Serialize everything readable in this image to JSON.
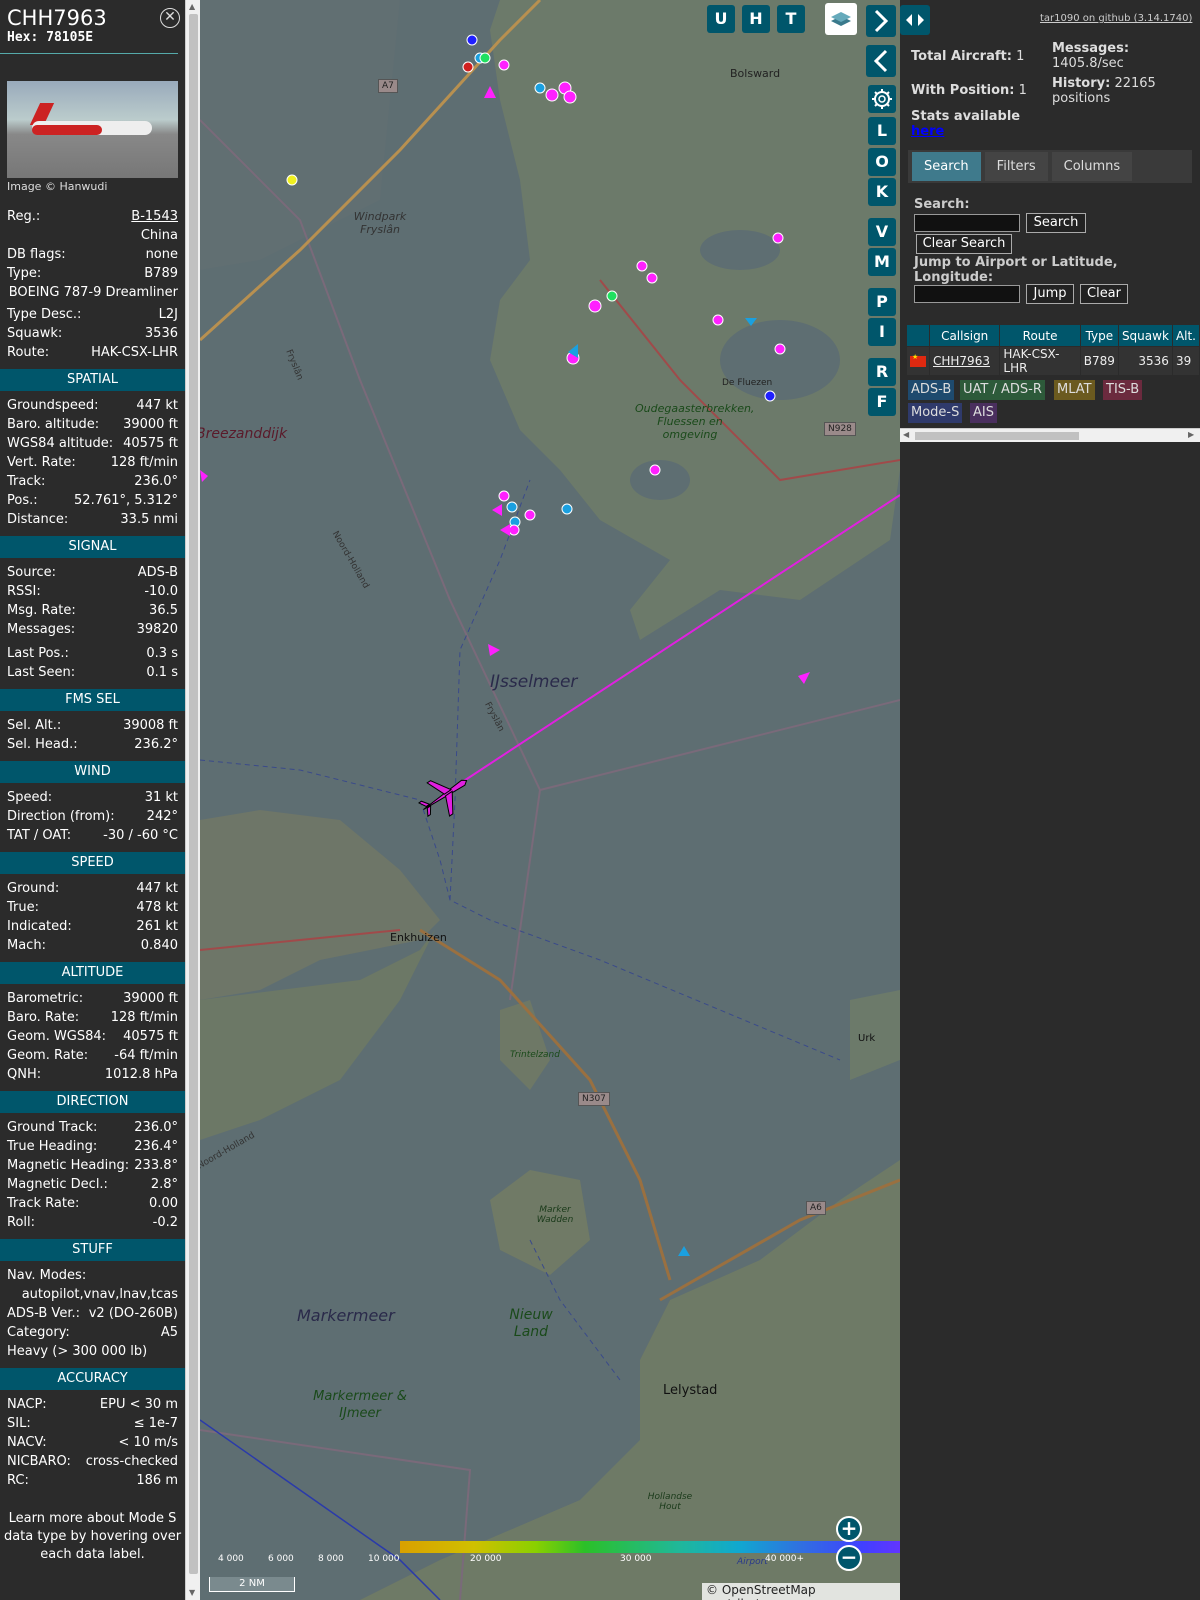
{
  "sidebar": {
    "callsign": "CHH7963",
    "hex": "Hex: 78105E",
    "photo_credit": "Image © Hanwudi",
    "reg_label": "Reg.:",
    "reg": "B-1543",
    "country": "China",
    "dbflags_label": "DB flags:",
    "dbflags": "none",
    "type_label": "Type:",
    "type": "B789",
    "type_full": "BOEING 787-9 Dreamliner",
    "typedesc_label": "Type Desc.:",
    "typedesc": "L2J",
    "squawk_label": "Squawk:",
    "squawk": "3536",
    "route_label": "Route:",
    "route": "HAK-CSX-LHR",
    "sections": {
      "spatial": "SPATIAL",
      "signal": "SIGNAL",
      "fms": "FMS SEL",
      "wind": "WIND",
      "speed": "SPEED",
      "altitude": "ALTITUDE",
      "direction": "DIRECTION",
      "stuff": "STUFF",
      "accuracy": "ACCURACY"
    },
    "spatial": [
      {
        "k": "Groundspeed:",
        "v": "447 kt"
      },
      {
        "k": "Baro. altitude:",
        "v": "39000 ft"
      },
      {
        "k": "WGS84 altitude:",
        "v": "40575 ft"
      },
      {
        "k": "Vert. Rate:",
        "v": "128 ft/min"
      },
      {
        "k": "Track:",
        "v": "236.0°"
      },
      {
        "k": "Pos.:",
        "v": "52.761°, 5.312°"
      },
      {
        "k": "Distance:",
        "v": "33.5 nmi"
      }
    ],
    "signal": [
      {
        "k": "Source:",
        "v": "ADS-B"
      },
      {
        "k": "RSSI:",
        "v": "-10.0"
      },
      {
        "k": "Msg. Rate:",
        "v": "36.5"
      },
      {
        "k": "Messages:",
        "v": "39820"
      },
      {
        "k": "Last Pos.:",
        "v": "0.3 s"
      },
      {
        "k": "Last Seen:",
        "v": "0.1 s"
      }
    ],
    "fms": [
      {
        "k": "Sel. Alt.:",
        "v": "39008 ft"
      },
      {
        "k": "Sel. Head.:",
        "v": "236.2°"
      }
    ],
    "wind": [
      {
        "k": "Speed:",
        "v": "31 kt"
      },
      {
        "k": "Direction (from):",
        "v": "242°"
      },
      {
        "k": "TAT / OAT:",
        "v": "-30 / -60 °C"
      }
    ],
    "speed": [
      {
        "k": "Ground:",
        "v": "447 kt"
      },
      {
        "k": "True:",
        "v": "478 kt"
      },
      {
        "k": "Indicated:",
        "v": "261 kt"
      },
      {
        "k": "Mach:",
        "v": "0.840"
      }
    ],
    "altitude": [
      {
        "k": "Barometric:",
        "v": "39000 ft"
      },
      {
        "k": "Baro. Rate:",
        "v": "128 ft/min"
      },
      {
        "k": "Geom. WGS84:",
        "v": "40575 ft"
      },
      {
        "k": "Geom. Rate:",
        "v": "-64 ft/min"
      },
      {
        "k": "QNH:",
        "v": "1012.8 hPa"
      }
    ],
    "direction": [
      {
        "k": "Ground Track:",
        "v": "236.0°"
      },
      {
        "k": "True Heading:",
        "v": "236.4°"
      },
      {
        "k": "Magnetic Heading:",
        "v": "233.8°"
      },
      {
        "k": "Magnetic Decl.:",
        "v": "2.8°"
      },
      {
        "k": "Track Rate:",
        "v": "0.00"
      },
      {
        "k": "Roll:",
        "v": "-0.2"
      }
    ],
    "navmodes_label": "Nav. Modes:",
    "navmodes": "autopilot,vnav,lnav,tcas",
    "adsbver_label": "ADS-B Ver.:",
    "adsbver": "v2 (DO-260B)",
    "category_label": "Category:",
    "category": "A5",
    "category_desc": "Heavy (> 300 000 lb)",
    "accuracy": [
      {
        "k": "NACP:",
        "v": "EPU < 30 m"
      },
      {
        "k": "SIL:",
        "v": "≤ 1e-7"
      },
      {
        "k": "NACV:",
        "v": "< 10 m/s"
      },
      {
        "k": "NICBARO:",
        "v": "cross-checked"
      },
      {
        "k": "RC:",
        "v": "186 m"
      }
    ],
    "note": "Learn more about Mode S data type by hovering over each data label."
  },
  "map": {
    "buttons_top": [
      "U",
      "H",
      "T"
    ],
    "buttons_side": [
      "L",
      "O",
      "K",
      "V",
      "M",
      "P",
      "I",
      "R",
      "F"
    ],
    "labels": {
      "bolsward": "Bolsward",
      "windpark": "Windpark Fryslân",
      "breezanddijk": "Breezanddijk",
      "frysian1": "Fryslân",
      "noordholland": "Noord-Holland",
      "ijsselmeer": "IJsselmeer",
      "frysian2": "Fryslân",
      "fluezen": "De Fluezen",
      "oudega": "Oudegaasterbrekken, Fluessen en omgeving",
      "enkhuizen": "Enkhuizen",
      "trintelzand": "Trintelzand",
      "urk": "Urk",
      "marker_wadden": "Marker Wadden",
      "markermeer": "Markermeer",
      "nieuw_land": "Nieuw Land",
      "markermeer_ijmeer": "Markermeer & IJmeer",
      "lelystad": "Lelystad",
      "hollandse_hout": "Hollandse Hout",
      "airport": "Airport",
      "noord_holland2": "Noord-Holland"
    },
    "roads": {
      "a7": "A7",
      "n928": "N928",
      "n307": "N307",
      "a6": "A6"
    },
    "altitude_legend": [
      "4 000",
      "6 000",
      "8 000",
      "10 000",
      "20 000",
      "30 000",
      "40 000+"
    ],
    "scale": "2 NM",
    "attribution": "© OpenStreetMap contributors."
  },
  "panel": {
    "github": "tar1090 on github (3.14.1740)",
    "total_label": "Total Aircraft:",
    "total": "1",
    "withpos_label": "With Position:",
    "withpos": "1",
    "messages_label": "Messages:",
    "messages": "1405.8/sec",
    "history_label": "History:",
    "history": "22165 positions",
    "stats_text": "Stats available",
    "stats_link": "here",
    "tabs": [
      "Search",
      "Filters",
      "Columns"
    ],
    "search_label": "Search:",
    "search_button": "Search",
    "clear_search": "Clear Search",
    "jump_label": "Jump to Airport or Latitude, Longitude:",
    "jump_button": "Jump",
    "clear_button": "Clear",
    "table_headers": [
      "",
      "Callsign",
      "Route",
      "Type",
      "Squawk",
      "Alt."
    ],
    "table_rows": [
      {
        "callsign": "CHH7963",
        "route": "HAK-CSX-LHR",
        "type": "B789",
        "squawk": "3536",
        "alt": "39"
      }
    ],
    "sources": [
      {
        "label": "ADS-B",
        "color": "#1e4a6e"
      },
      {
        "label": "UAT / ADS-R",
        "color": "#2d5a3a"
      },
      {
        "label": "MLAT",
        "color": "#6b5a1f"
      },
      {
        "label": "TIS-B",
        "color": "#6b2a3e"
      },
      {
        "label": "Mode-S",
        "color": "#2f3a6b"
      },
      {
        "label": "AIS",
        "color": "#4a2f5e"
      }
    ]
  }
}
